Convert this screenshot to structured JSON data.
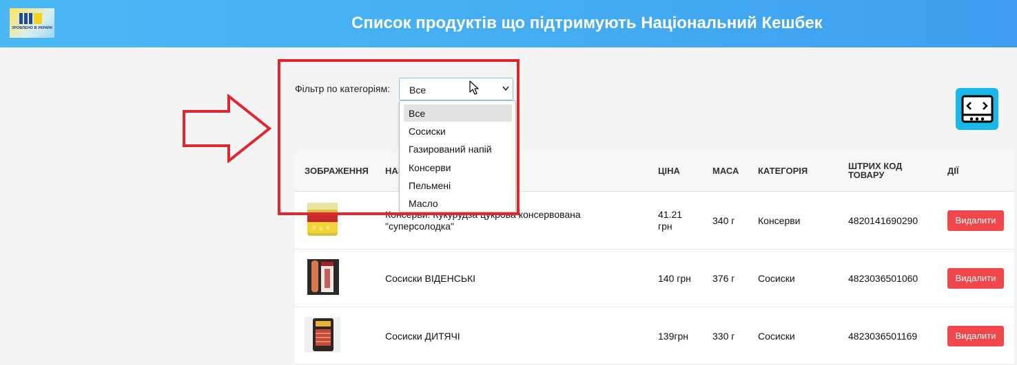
{
  "header": {
    "logo_text": "ЗРОБЛЕНО В УКРАЇНІ",
    "title": "Список продуктів що підтримують Національний Кешбек"
  },
  "filter": {
    "label": "Фільтр по категоріям:",
    "selected": "Все",
    "options": [
      "Все",
      "Сосиски",
      "Газирований напій",
      "Консерви",
      "Пельмені",
      "Масло"
    ]
  },
  "table": {
    "headers": {
      "image": "Зображення",
      "name": "Назва",
      "price": "Ціна",
      "mass": "Маса",
      "category": "Категорія",
      "barcode": "Штрих код товару",
      "actions": "Дії"
    },
    "rows": [
      {
        "name": "Консерви: Кукурудза цукрова консервована \"суперсолодка\"",
        "price": "41.21 грн",
        "mass": "340 г",
        "category": "Консерви",
        "barcode": "4820141690290",
        "action": "Видалити"
      },
      {
        "name": "Сосиски ВІДЕНСЬКІ",
        "price": "140 грн",
        "mass": "376 г",
        "category": "Сосиски",
        "barcode": "4823036501060",
        "action": "Видалити"
      },
      {
        "name": "Сосиски ДИТЯЧІ",
        "price": "139грн",
        "mass": "330 г",
        "category": "Сосиски",
        "barcode": "4823036501169",
        "action": "Видалити"
      }
    ]
  },
  "colors": {
    "header": "#45aef3",
    "delete_button": "#f0474c",
    "highlight_box": "#e0262f",
    "widget": "#19b7ea"
  }
}
